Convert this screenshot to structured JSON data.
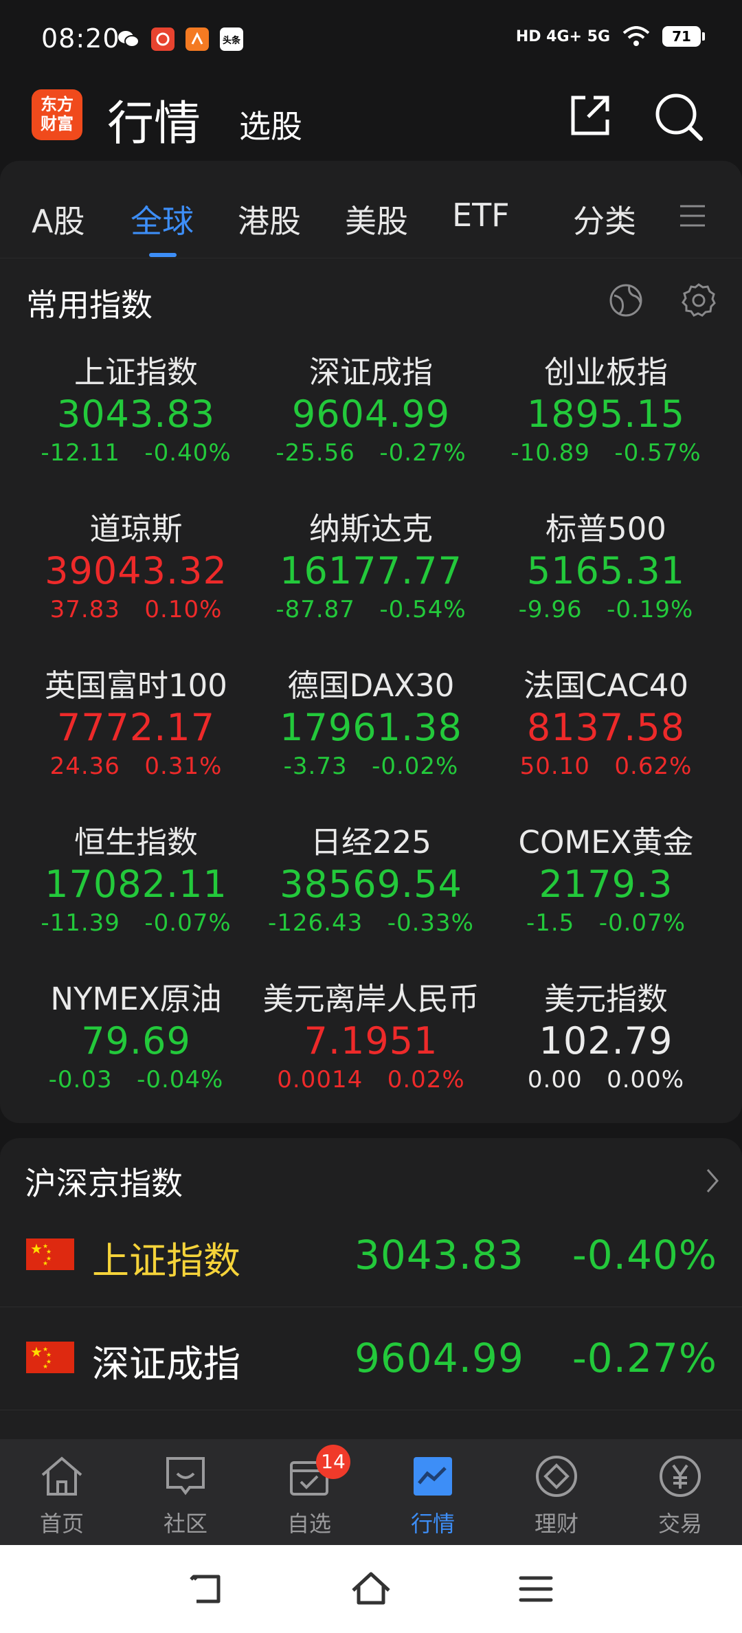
{
  "status_bar": {
    "time": "08:20",
    "notif_icons": [
      "wechat-icon",
      "app-icon",
      "app-icon",
      "toutiao-icon"
    ],
    "toutiao_text": "头条",
    "network": "HD 4G+ 5G",
    "battery": "71"
  },
  "header": {
    "logo_text_1": "东方",
    "logo_text_2": "财富",
    "title": "行情",
    "subtitle": "选股"
  },
  "tabs": [
    {
      "label": "A股",
      "active": false
    },
    {
      "label": "全球",
      "active": true
    },
    {
      "label": "港股",
      "active": false
    },
    {
      "label": "美股",
      "active": false
    },
    {
      "label": "ETF",
      "active": false
    },
    {
      "label": "分类",
      "active": false
    }
  ],
  "common_indices": {
    "title": "常用指数",
    "items": [
      {
        "name": "上证指数",
        "price": "3043.83",
        "change": "-12.11",
        "pct": "-0.40%",
        "dir": "down"
      },
      {
        "name": "深证成指",
        "price": "9604.99",
        "change": "-25.56",
        "pct": "-0.27%",
        "dir": "down"
      },
      {
        "name": "创业板指",
        "price": "1895.15",
        "change": "-10.89",
        "pct": "-0.57%",
        "dir": "down"
      },
      {
        "name": "道琼斯",
        "price": "39043.32",
        "change": "37.83",
        "pct": "0.10%",
        "dir": "up"
      },
      {
        "name": "纳斯达克",
        "price": "16177.77",
        "change": "-87.87",
        "pct": "-0.54%",
        "dir": "down"
      },
      {
        "name": "标普500",
        "price": "5165.31",
        "change": "-9.96",
        "pct": "-0.19%",
        "dir": "down"
      },
      {
        "name": "英国富时100",
        "price": "7772.17",
        "change": "24.36",
        "pct": "0.31%",
        "dir": "up"
      },
      {
        "name": "德国DAX30",
        "price": "17961.38",
        "change": "-3.73",
        "pct": "-0.02%",
        "dir": "down"
      },
      {
        "name": "法国CAC40",
        "price": "8137.58",
        "change": "50.10",
        "pct": "0.62%",
        "dir": "up"
      },
      {
        "name": "恒生指数",
        "price": "17082.11",
        "change": "-11.39",
        "pct": "-0.07%",
        "dir": "down"
      },
      {
        "name": "日经225",
        "price": "38569.54",
        "change": "-126.43",
        "pct": "-0.33%",
        "dir": "down"
      },
      {
        "name": "COMEX黄金",
        "price": "2179.3",
        "change": "-1.5",
        "pct": "-0.07%",
        "dir": "down"
      },
      {
        "name": "NYMEX原油",
        "price": "79.69",
        "change": "-0.03",
        "pct": "-0.04%",
        "dir": "down"
      },
      {
        "name": "美元离岸人民币",
        "price": "7.1951",
        "change": "0.0014",
        "pct": "0.02%",
        "dir": "up"
      },
      {
        "name": "美元指数",
        "price": "102.79",
        "change": "0.00",
        "pct": "0.00%",
        "dir": "flat"
      }
    ]
  },
  "hsj_indices": {
    "title": "沪深京指数",
    "rows": [
      {
        "name": "上证指数",
        "price": "3043.83",
        "pct": "-0.40%",
        "name_color": "#f5d33a"
      },
      {
        "name": "深证成指",
        "price": "9604.99",
        "pct": "-0.27%",
        "name_color": "#ffffff"
      }
    ]
  },
  "bottom_nav": [
    {
      "label": "首页",
      "icon": "home-icon",
      "active": false
    },
    {
      "label": "社区",
      "icon": "community-icon",
      "active": false
    },
    {
      "label": "自选",
      "icon": "watchlist-icon",
      "active": false,
      "badge": "14"
    },
    {
      "label": "行情",
      "icon": "market-chart-icon",
      "active": true
    },
    {
      "label": "理财",
      "icon": "wealth-icon",
      "active": false
    },
    {
      "label": "交易",
      "icon": "trade-yen-icon",
      "active": false
    }
  ],
  "colors": {
    "up": "#ee2a2a",
    "down": "#23c93b",
    "accent": "#3d8ef7",
    "brand": "#f04a1c"
  }
}
